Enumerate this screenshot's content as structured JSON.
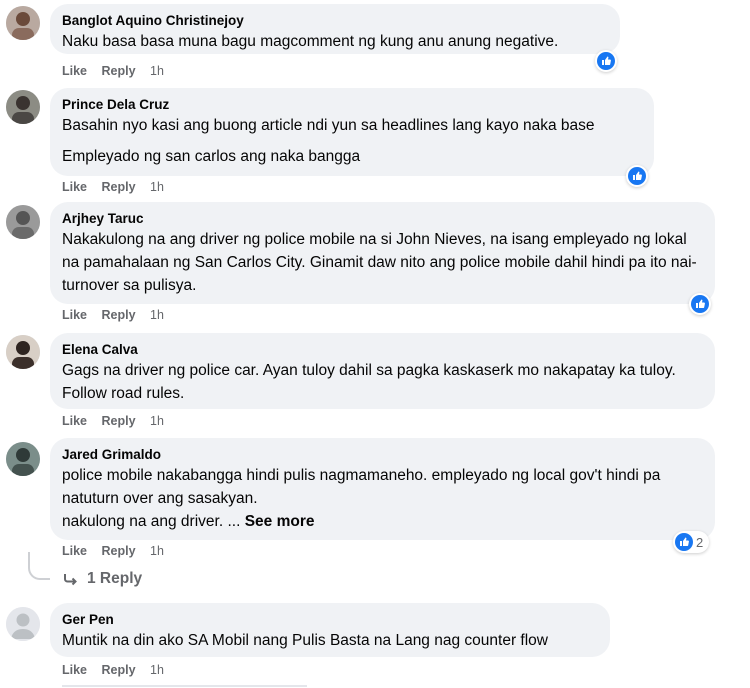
{
  "actions": {
    "like": "Like",
    "reply": "Reply"
  },
  "colors": {
    "like_blue": "#1877f2",
    "bubble_bg": "#f0f2f5",
    "secondary_text": "#65676b"
  },
  "comments": [
    {
      "name": "Banglot Aquino Christinejoy",
      "lines": [
        "Naku basa basa muna bagu magcomment ng kung anu anung negative."
      ],
      "time": "1h",
      "reaction": "like-icon"
    },
    {
      "name": "Prince Dela Cruz",
      "lines": [
        "Basahin nyo kasi ang buong article ndi yun sa headlines lang kayo naka base",
        "Empleyado ng san carlos ang naka bangga"
      ],
      "time": "1h",
      "reaction": "like-icon"
    },
    {
      "name": "Arjhey Taruc",
      "lines": [
        "Nakakulong na ang driver ng police mobile na si John Nieves, na isang empleyado ng lokal na pamahalaan ng San Carlos City. Ginamit daw nito ang police mobile dahil hindi pa ito nai-turnover sa pulisya."
      ],
      "time": "1h",
      "reaction": "like-icon"
    },
    {
      "name": "Elena Calva",
      "lines": [
        "Gags na driver ng police car. Ayan tuloy dahil sa pagka kaskaserk mo nakapatay ka tuloy. Follow road rules."
      ],
      "time": "1h"
    },
    {
      "name": "Jared Grimaldo",
      "lines": [
        "police mobile nakabangga hindi pulis nagmamaneho. empleyado ng local gov't hindi pa natuturn over ang sasakyan.",
        "nakulong na ang driver. ..."
      ],
      "see_more": "See more",
      "time": "1h",
      "reaction": "like-icon",
      "reaction_count": "2",
      "replies_label": "1 Reply"
    },
    {
      "name": "Ger Pen",
      "lines": [
        "Muntik na din ako SA Mobil nang Pulis Basta na Lang nag counter flow"
      ],
      "time": "1h"
    }
  ]
}
